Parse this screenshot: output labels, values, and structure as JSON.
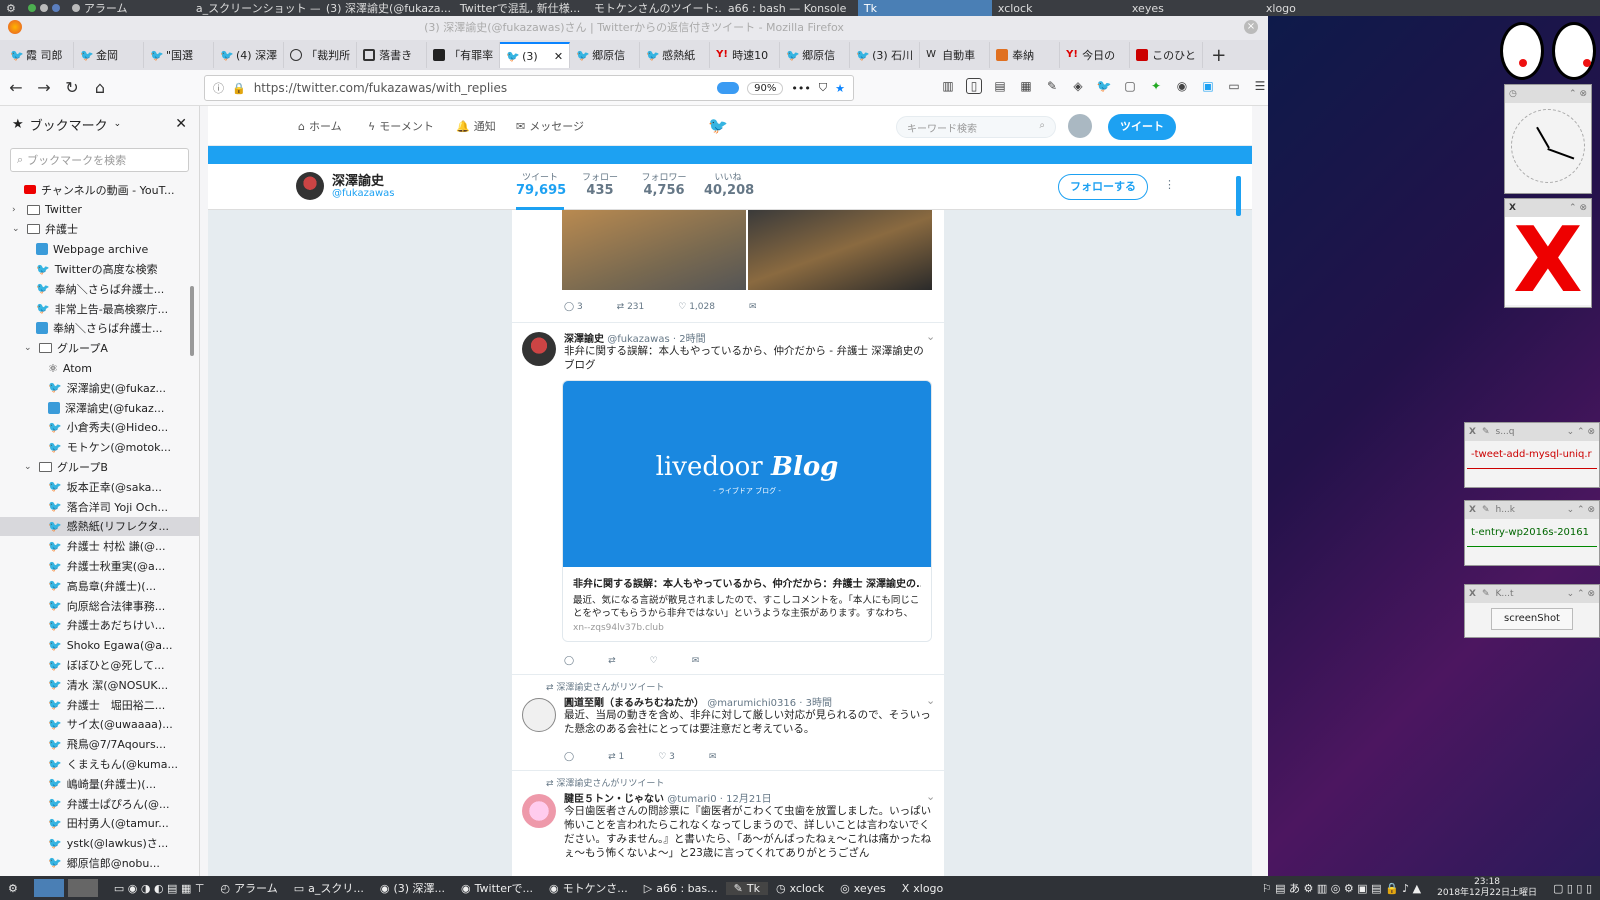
{
  "topbar": {
    "items": [
      "アラーム",
      "a_スクリーンショット —...",
      "(3) 深澤諭史(@fukaza...",
      "Twitterで混乱, 新仕様...",
      "モトケンさんのツイート:...",
      "a66 : bash — Konsole",
      "Tk",
      "xclock",
      "xeyes",
      "xlogo"
    ]
  },
  "window": {
    "title": "(3) 深澤諭史(@fukazawas)さん | Twitterからの返信付きツイート - Mozilla Firefox"
  },
  "tabs": [
    "霞 司郎",
    "金岡",
    "\"国選",
    "(4) 深澤",
    "「裁判所",
    "落書き",
    "「有罪率",
    "(3)",
    "郷原信",
    "感熱紙",
    "時速10",
    "郷原信",
    "(3) 石川",
    "自動車",
    "奉納",
    "今日の",
    "このひと"
  ],
  "navbar": {
    "url": "https://twitter.com/fukazawas/with_replies",
    "zoom": "90%"
  },
  "sidebar": {
    "title": "ブックマーク",
    "search_placeholder": "ブックマークを検索",
    "items": [
      {
        "label": "チャンネルの動画 - YouT...",
        "kind": "yt"
      },
      {
        "label": "Twitter",
        "kind": "folder"
      },
      {
        "label": "弁護士",
        "kind": "folder-open"
      },
      {
        "label": "Webpage archive",
        "kind": "page"
      },
      {
        "label": "Twitterの高度な検索",
        "kind": "tw"
      },
      {
        "label": "奉納＼さらば弁護士...",
        "kind": "tw"
      },
      {
        "label": "非常上告-最高検察庁...",
        "kind": "tw"
      },
      {
        "label": "奉納＼さらば弁護士...",
        "kind": "page"
      },
      {
        "label": "グループA",
        "kind": "folder-open"
      },
      {
        "label": "Atom",
        "kind": "atom"
      },
      {
        "label": "深澤諭史(@fukaz...",
        "kind": "tw"
      },
      {
        "label": "深澤諭史(@fukaz...",
        "kind": "page"
      },
      {
        "label": "小倉秀夫(@Hideo...",
        "kind": "tw"
      },
      {
        "label": "モトケン(@motok...",
        "kind": "tw"
      },
      {
        "label": "グループB",
        "kind": "folder-open"
      },
      {
        "label": "坂本正幸(@saka...",
        "kind": "tw"
      },
      {
        "label": "落合洋司 Yoji Och...",
        "kind": "tw"
      },
      {
        "label": "感熱紙(リフレクタ...",
        "kind": "tw"
      },
      {
        "label": "弁護士 村松 謙(@...",
        "kind": "tw"
      },
      {
        "label": "弁護士秋重実(@a...",
        "kind": "tw"
      },
      {
        "label": "高島章(弁護士)(...",
        "kind": "tw"
      },
      {
        "label": "向原総合法律事務...",
        "kind": "tw"
      },
      {
        "label": "弁護士あだちけい...",
        "kind": "tw"
      },
      {
        "label": "Shoko Egawa(@a...",
        "kind": "tw"
      },
      {
        "label": "ぼぼひと@死して...",
        "kind": "tw"
      },
      {
        "label": "清水 潔(@NOSUK...",
        "kind": "tw"
      },
      {
        "label": "弁護士　堀田裕二...",
        "kind": "tw"
      },
      {
        "label": "サイ太(@uwaaaa)...",
        "kind": "tw"
      },
      {
        "label": "飛鳥@7/7Aqours...",
        "kind": "tw"
      },
      {
        "label": "くまえもん(@kuma...",
        "kind": "tw"
      },
      {
        "label": "嶋崎量(弁護士)(...",
        "kind": "tw"
      },
      {
        "label": "弁護士ぱぴろん(@...",
        "kind": "tw"
      },
      {
        "label": "田村勇人(@tamur...",
        "kind": "tw"
      },
      {
        "label": "ystk(@lawkus)さ...",
        "kind": "tw"
      },
      {
        "label": "郷原信郎@nobu...",
        "kind": "tw"
      }
    ]
  },
  "twitter": {
    "nav": {
      "home": "ホーム",
      "moments": "モーメント",
      "notifications": "通知",
      "messages": "メッセージ"
    },
    "search_placeholder": "キーワード検索",
    "tweet_button": "ツイート",
    "profile": {
      "name": "深澤諭史",
      "handle": "@fukazawas",
      "stats": [
        {
          "label": "ツイート",
          "value": "79,695"
        },
        {
          "label": "フォロー",
          "value": "435"
        },
        {
          "label": "フォロワー",
          "value": "4,756"
        },
        {
          "label": "いいね",
          "value": "40,208"
        }
      ],
      "follow_label": "フォローする"
    },
    "tweet0": {
      "reply": "3",
      "retweet": "231",
      "like": "1,028"
    },
    "tweet1": {
      "name": "深澤諭史",
      "handle": "@fukazawas",
      "time": "· 2時間",
      "text": "非弁に関する誤解：本人もやっているから、仲介だから - 弁護士 深澤諭史のブログ",
      "card_logo": "livedoor",
      "card_logo2": "Blog",
      "card_sub": "- ライブドア ブログ -",
      "card_title": "非弁に関する誤解：本人もやっているから、仲介だから：弁護士 深澤諭史の...",
      "card_desc": "最近、気になる言説が散見されましたので、すこしコメントを。「本人にも同じことをやってもらうから非弁ではない」というような主張があります。すなわち、業者と...",
      "card_domain": "xn--zqs94lv37b.club"
    },
    "tweet2": {
      "rt": "深澤諭史さんがリツイート",
      "name": "圓道至剛（まるみちむねたか）",
      "handle": "@marumichi0316",
      "time": "· 3時間",
      "text": "最近、当局の動きを含め、非弁に対して厳しい対応が見られるので、そういった懸念のある会社にとっては要注意だと考えている。",
      "retweet": "1",
      "like": "3"
    },
    "tweet3": {
      "rt": "深澤諭史さんがリツイート",
      "name": "腱臣５トン・じゃない",
      "handle": "@tumari0",
      "time": "· 12月21日",
      "text": "今日歯医者さんの問診票に『歯医者がこわくて虫歯を放置しました。いっぱい怖いことを言われたらこれなくなってしまうので、詳しいことは言わないでください。すみません。』と書いたら、「あ〜がんばったねぇ〜これは痛かったねぇ〜もう怖くないよ〜」と23歳に言ってくれてありがとうござん"
    }
  },
  "desktop": {
    "win1_title": "s...q",
    "win1_text": "-tweet-add-mysql-uniq.r",
    "win2_title": "h...k",
    "win2_text": "t-entry-wp2016s-20161",
    "win3_title": "K...t",
    "win3_button": "screenShot"
  },
  "bottombar": {
    "items": [
      "アラーム",
      "a_スクリ...",
      "(3) 深澤...",
      "Twitterで...",
      "モトケンさ...",
      "a66 : bas...",
      "Tk",
      "xclock",
      "xeyes",
      "xlogo"
    ],
    "time": "23:18",
    "date": "2018年12月22日土曜日"
  }
}
